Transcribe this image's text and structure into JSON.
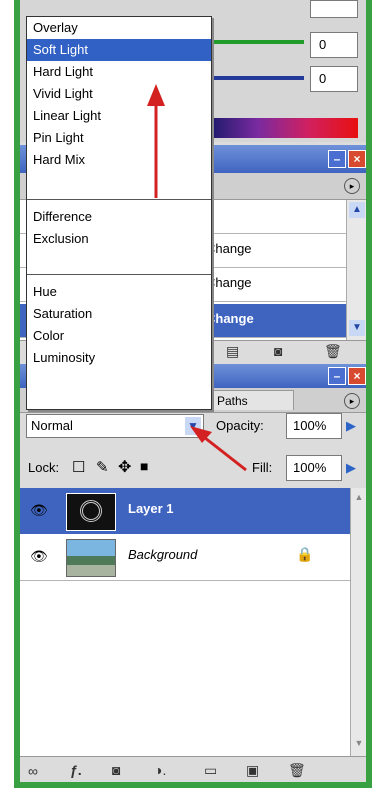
{
  "color_panel": {
    "value_1": "0",
    "value_2": "0",
    "accent_green": "#1f9c2a",
    "accent_blue": "#233a9a"
  },
  "blend_menu": {
    "groups": [
      [
        "Overlay",
        "Soft Light",
        "Hard Light",
        "Vivid Light",
        "Linear Light",
        "Pin Light",
        "Hard Mix"
      ],
      [
        "Difference",
        "Exclusion"
      ],
      [
        "Hue",
        "Saturation",
        "Color",
        "Luminosity"
      ]
    ],
    "selected": "Soft Light"
  },
  "history_panel": {
    "rows": [
      "Change",
      "Change",
      "Change"
    ],
    "selected_index": 2
  },
  "layers_panel": {
    "tab_paths": "Paths",
    "blend_mode": "Normal",
    "opacity_label": "Opacity:",
    "opacity_value": "100%",
    "lock_label": "Lock:",
    "fill_label": "Fill:",
    "fill_value": "100%",
    "layers": [
      {
        "name": "Layer 1",
        "selected": true
      },
      {
        "name": "Background",
        "selected": false,
        "locked": true
      }
    ]
  },
  "annotation_color": "#d32020"
}
